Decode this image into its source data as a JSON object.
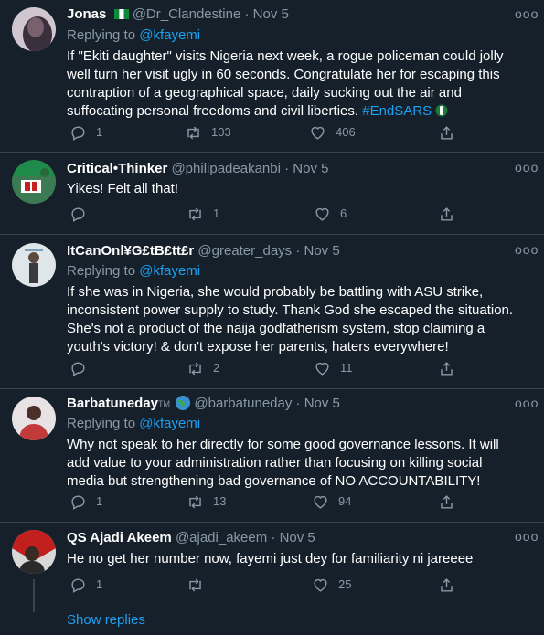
{
  "tweets": [
    {
      "name": "Jonas",
      "handle": "@Dr_Clandestine",
      "sep": "·",
      "time": "Nov 5",
      "replying_prefix": "Replying to",
      "replying_to": "@kfayemi",
      "text": "If \"Ekiti daughter\" visits Nigeria next week, a rogue policeman could jolly well turn her visit ugly in 60 seconds. Congratulate her for escaping this contraption of a geographical space, daily sucking out the air and suffocating personal freedoms and civil liberties.",
      "hashtag": "#EndSARS",
      "replies": "1",
      "retweets": "103",
      "likes": "406"
    },
    {
      "name": "Critical•Thinker",
      "handle": "@philipadeakanbi",
      "sep": "·",
      "time": "Nov 5",
      "text": "Yikes! Felt all that!",
      "replies": "",
      "retweets": "1",
      "likes": "6"
    },
    {
      "name": "ItCanOnl¥G£tB£tt£r",
      "handle": "@greater_days",
      "sep": "·",
      "time": "Nov 5",
      "replying_prefix": "Replying to",
      "replying_to": "@kfayemi",
      "text": "If she was in Nigeria, she would probably be battling with ASU strike, inconsistent power supply to study. Thank God she escaped the situation. She's not a product of the naija godfatherism system, stop claiming a youth's victory! & don't expose her parents, haters everywhere!",
      "replies": "",
      "retweets": "2",
      "likes": "11"
    },
    {
      "name": "Barbatuneday",
      "name_suffix": "TM",
      "handle": "@barbatuneday",
      "sep": "·",
      "time": "Nov 5",
      "replying_prefix": "Replying to",
      "replying_to": "@kfayemi",
      "text": "Why not speak to her directly for some good governance lessons. It will add value to your administration rather than focusing on killing social media but strengthening bad governance of NO ACCOUNTABILITY!",
      "replies": "1",
      "retweets": "13",
      "likes": "94"
    },
    {
      "name": "QS Ajadi Akeem",
      "handle": "@ajadi_akeem",
      "sep": "·",
      "time": "Nov 5",
      "text": "He no get her number now, fayemi just dey for familiarity ni jareeee",
      "replies": "1",
      "retweets": "",
      "likes": "25"
    }
  ],
  "show_replies": "Show replies",
  "more_glyph": "ooo",
  "colors": {
    "bg": "#15202b",
    "muted": "#8899a6",
    "link": "#1da1f2",
    "border": "#38444d"
  }
}
